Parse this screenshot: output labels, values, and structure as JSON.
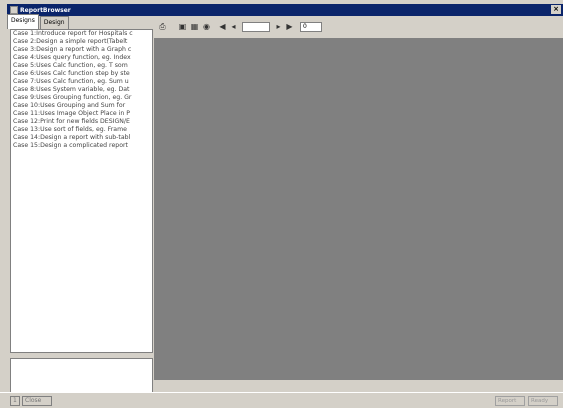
{
  "window": {
    "title": "ReportBrowser",
    "close_label": "×"
  },
  "tabs": [
    {
      "label": "Designs"
    },
    {
      "label": "Design"
    }
  ],
  "cases": [
    "Case 1:Introduce report for Hospitals c",
    "Case 2:Design a simple report(Tabelt",
    "Case 3:Design a report with a Graph c",
    "Case 4:Uses query function, eg. Index",
    "Case 5:Uses Calc function, eg. T som",
    "Case 6:Uses Calc function step by ste",
    "Case 7:Uses Calc function, eg. Sum u",
    "Case 8:Uses System variable, eg. Dat",
    "Case 9:Uses Grouping function, eg. Gr",
    "Case 10:Uses Grouping and Sum for",
    "Case 11:Uses Image Object Place in P",
    "Case 12:Print for new fields DESIGN/E",
    "Case 13:Use sort of fields, eg. Frame",
    "Case 14:Design a report with sub-tabl",
    "Case 15:Design a complicated report"
  ],
  "toolbar": {
    "page_value": "",
    "zoom_value": "0",
    "icons": [
      "print-icon",
      "save-icon",
      "export-icon",
      "setup-icon",
      "first-page-icon",
      "prev-page-icon",
      "next-page-icon",
      "last-page-icon"
    ]
  },
  "status": {
    "left_button_1": "1",
    "left_button_2": "Close",
    "right_panel_1": "Report",
    "right_panel_2": "Ready"
  }
}
